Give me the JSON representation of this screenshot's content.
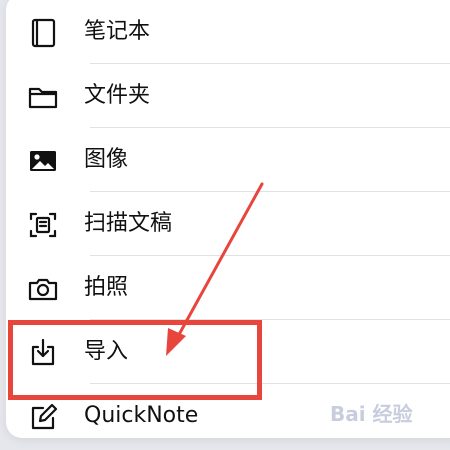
{
  "menu": {
    "items": [
      {
        "label": "笔记本",
        "icon": "notebook-icon"
      },
      {
        "label": "文件夹",
        "icon": "folder-icon"
      },
      {
        "label": "图像",
        "icon": "image-icon"
      },
      {
        "label": "扫描文稿",
        "icon": "scan-document-icon"
      },
      {
        "label": "拍照",
        "icon": "camera-icon"
      },
      {
        "label": "导入",
        "icon": "import-icon"
      },
      {
        "label": "QuickNote",
        "icon": "quicknote-icon"
      }
    ]
  },
  "annotation": {
    "highlight_color": "#e8453c",
    "highlighted_item": "导入"
  },
  "watermark": {
    "text": "Bai 经验"
  }
}
